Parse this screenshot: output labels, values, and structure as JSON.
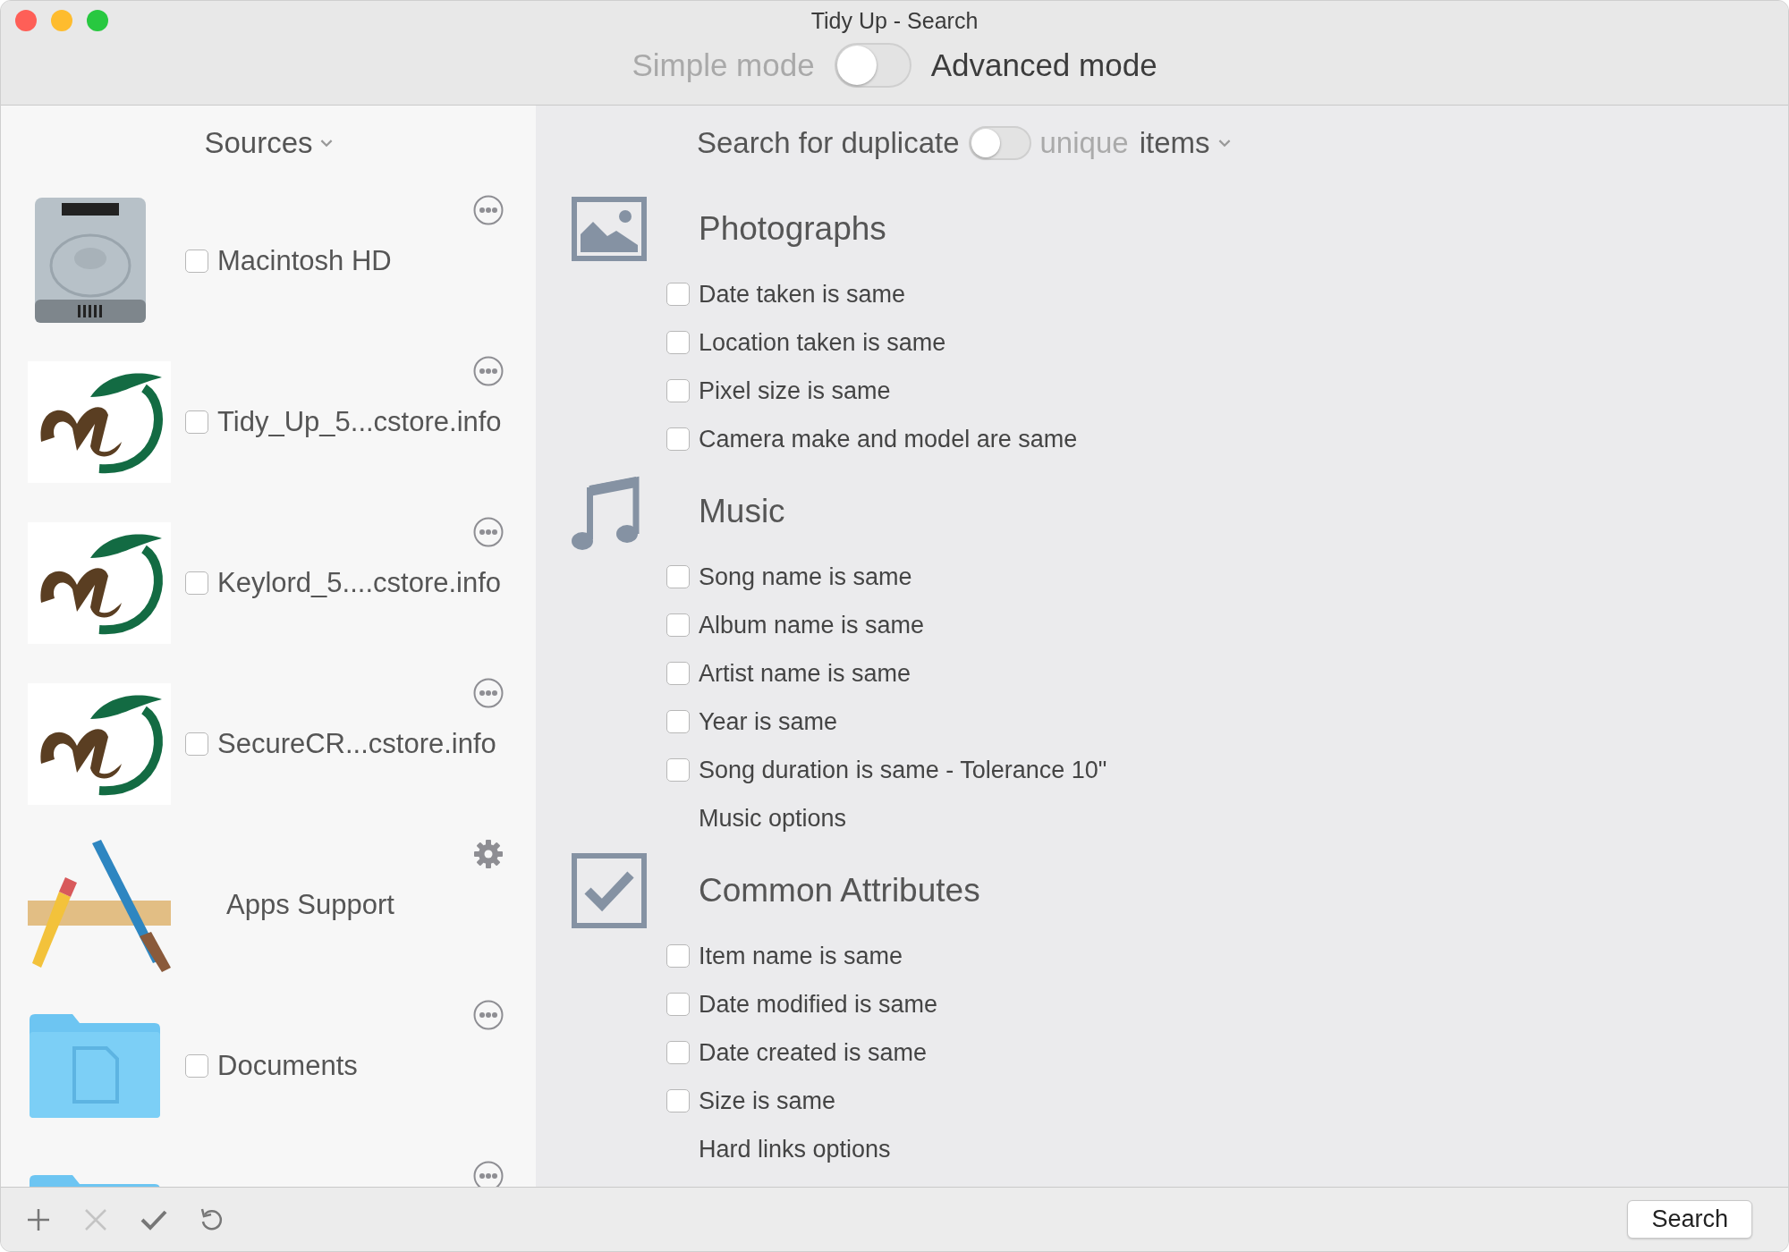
{
  "window": {
    "title": "Tidy Up - Search"
  },
  "mode_switch": {
    "left_label": "Simple mode",
    "left_dimmed": true,
    "on": false,
    "right_label": "Advanced mode",
    "right_dimmed": false
  },
  "sidebar": {
    "header": "Sources",
    "items": [
      {
        "kind": "drive",
        "name": "Macintosh HD",
        "checked": false,
        "action": {
          "kind": "more"
        }
      },
      {
        "kind": "logo",
        "name": "Tidy_Up_5...cstore.info",
        "checked": false,
        "action": {
          "kind": "more"
        }
      },
      {
        "kind": "logo",
        "name": "Keylord_5....cstore.info",
        "checked": false,
        "action": {
          "kind": "more"
        }
      },
      {
        "kind": "logo",
        "name": "SecureCR...cstore.info",
        "checked": false,
        "action": {
          "kind": "more"
        }
      },
      {
        "kind": "apps",
        "name": "Apps Support",
        "action": {
          "kind": "settings"
        }
      },
      {
        "kind": "folder",
        "name": "Documents",
        "checked": false,
        "action": {
          "kind": "more"
        }
      },
      {
        "kind": "folder",
        "action": {
          "kind": "more"
        }
      }
    ]
  },
  "search_bar": {
    "left_label": "Search for duplicate",
    "left_dimmed": false,
    "on": false,
    "right_label": "unique",
    "right_dimmed": true,
    "menu_label": "items"
  },
  "sections": [
    {
      "kind": "photo",
      "title": "Photographs",
      "options": [
        {
          "kind": "checkbox",
          "label": "Date taken is same",
          "checked": false
        },
        {
          "kind": "checkbox",
          "label": "Location taken is same",
          "checked": false
        },
        {
          "kind": "checkbox",
          "label": "Pixel size is same",
          "checked": false
        },
        {
          "kind": "checkbox",
          "label": "Camera make and model are same",
          "checked": false
        }
      ]
    },
    {
      "kind": "music",
      "title": "Music",
      "options": [
        {
          "kind": "checkbox",
          "label": "Song name is same",
          "checked": false
        },
        {
          "kind": "checkbox",
          "label": "Album name is same",
          "checked": false
        },
        {
          "kind": "checkbox",
          "label": "Artist name is same",
          "checked": false
        },
        {
          "kind": "checkbox",
          "label": "Year is same",
          "checked": false
        },
        {
          "kind": "checkbox",
          "label": "Song duration is same - Tolerance 10\"",
          "checked": false
        },
        {
          "kind": "link",
          "label": "Music options"
        }
      ]
    },
    {
      "kind": "check",
      "title": "Common Attributes",
      "options": [
        {
          "kind": "checkbox",
          "label": "Item name is same",
          "checked": false
        },
        {
          "kind": "checkbox",
          "label": "Date modified is same",
          "checked": false
        },
        {
          "kind": "checkbox",
          "label": "Date created is same",
          "checked": false
        },
        {
          "kind": "checkbox",
          "label": "Size is same",
          "checked": false
        },
        {
          "kind": "link",
          "label": "Hard links options"
        }
      ]
    }
  ],
  "toolbar": [
    {
      "kind": "add",
      "disabled": false
    },
    {
      "kind": "remove",
      "disabled": true
    },
    {
      "kind": "check",
      "disabled": false
    },
    {
      "kind": "undo",
      "disabled": false
    }
  ],
  "search_button": "Search"
}
